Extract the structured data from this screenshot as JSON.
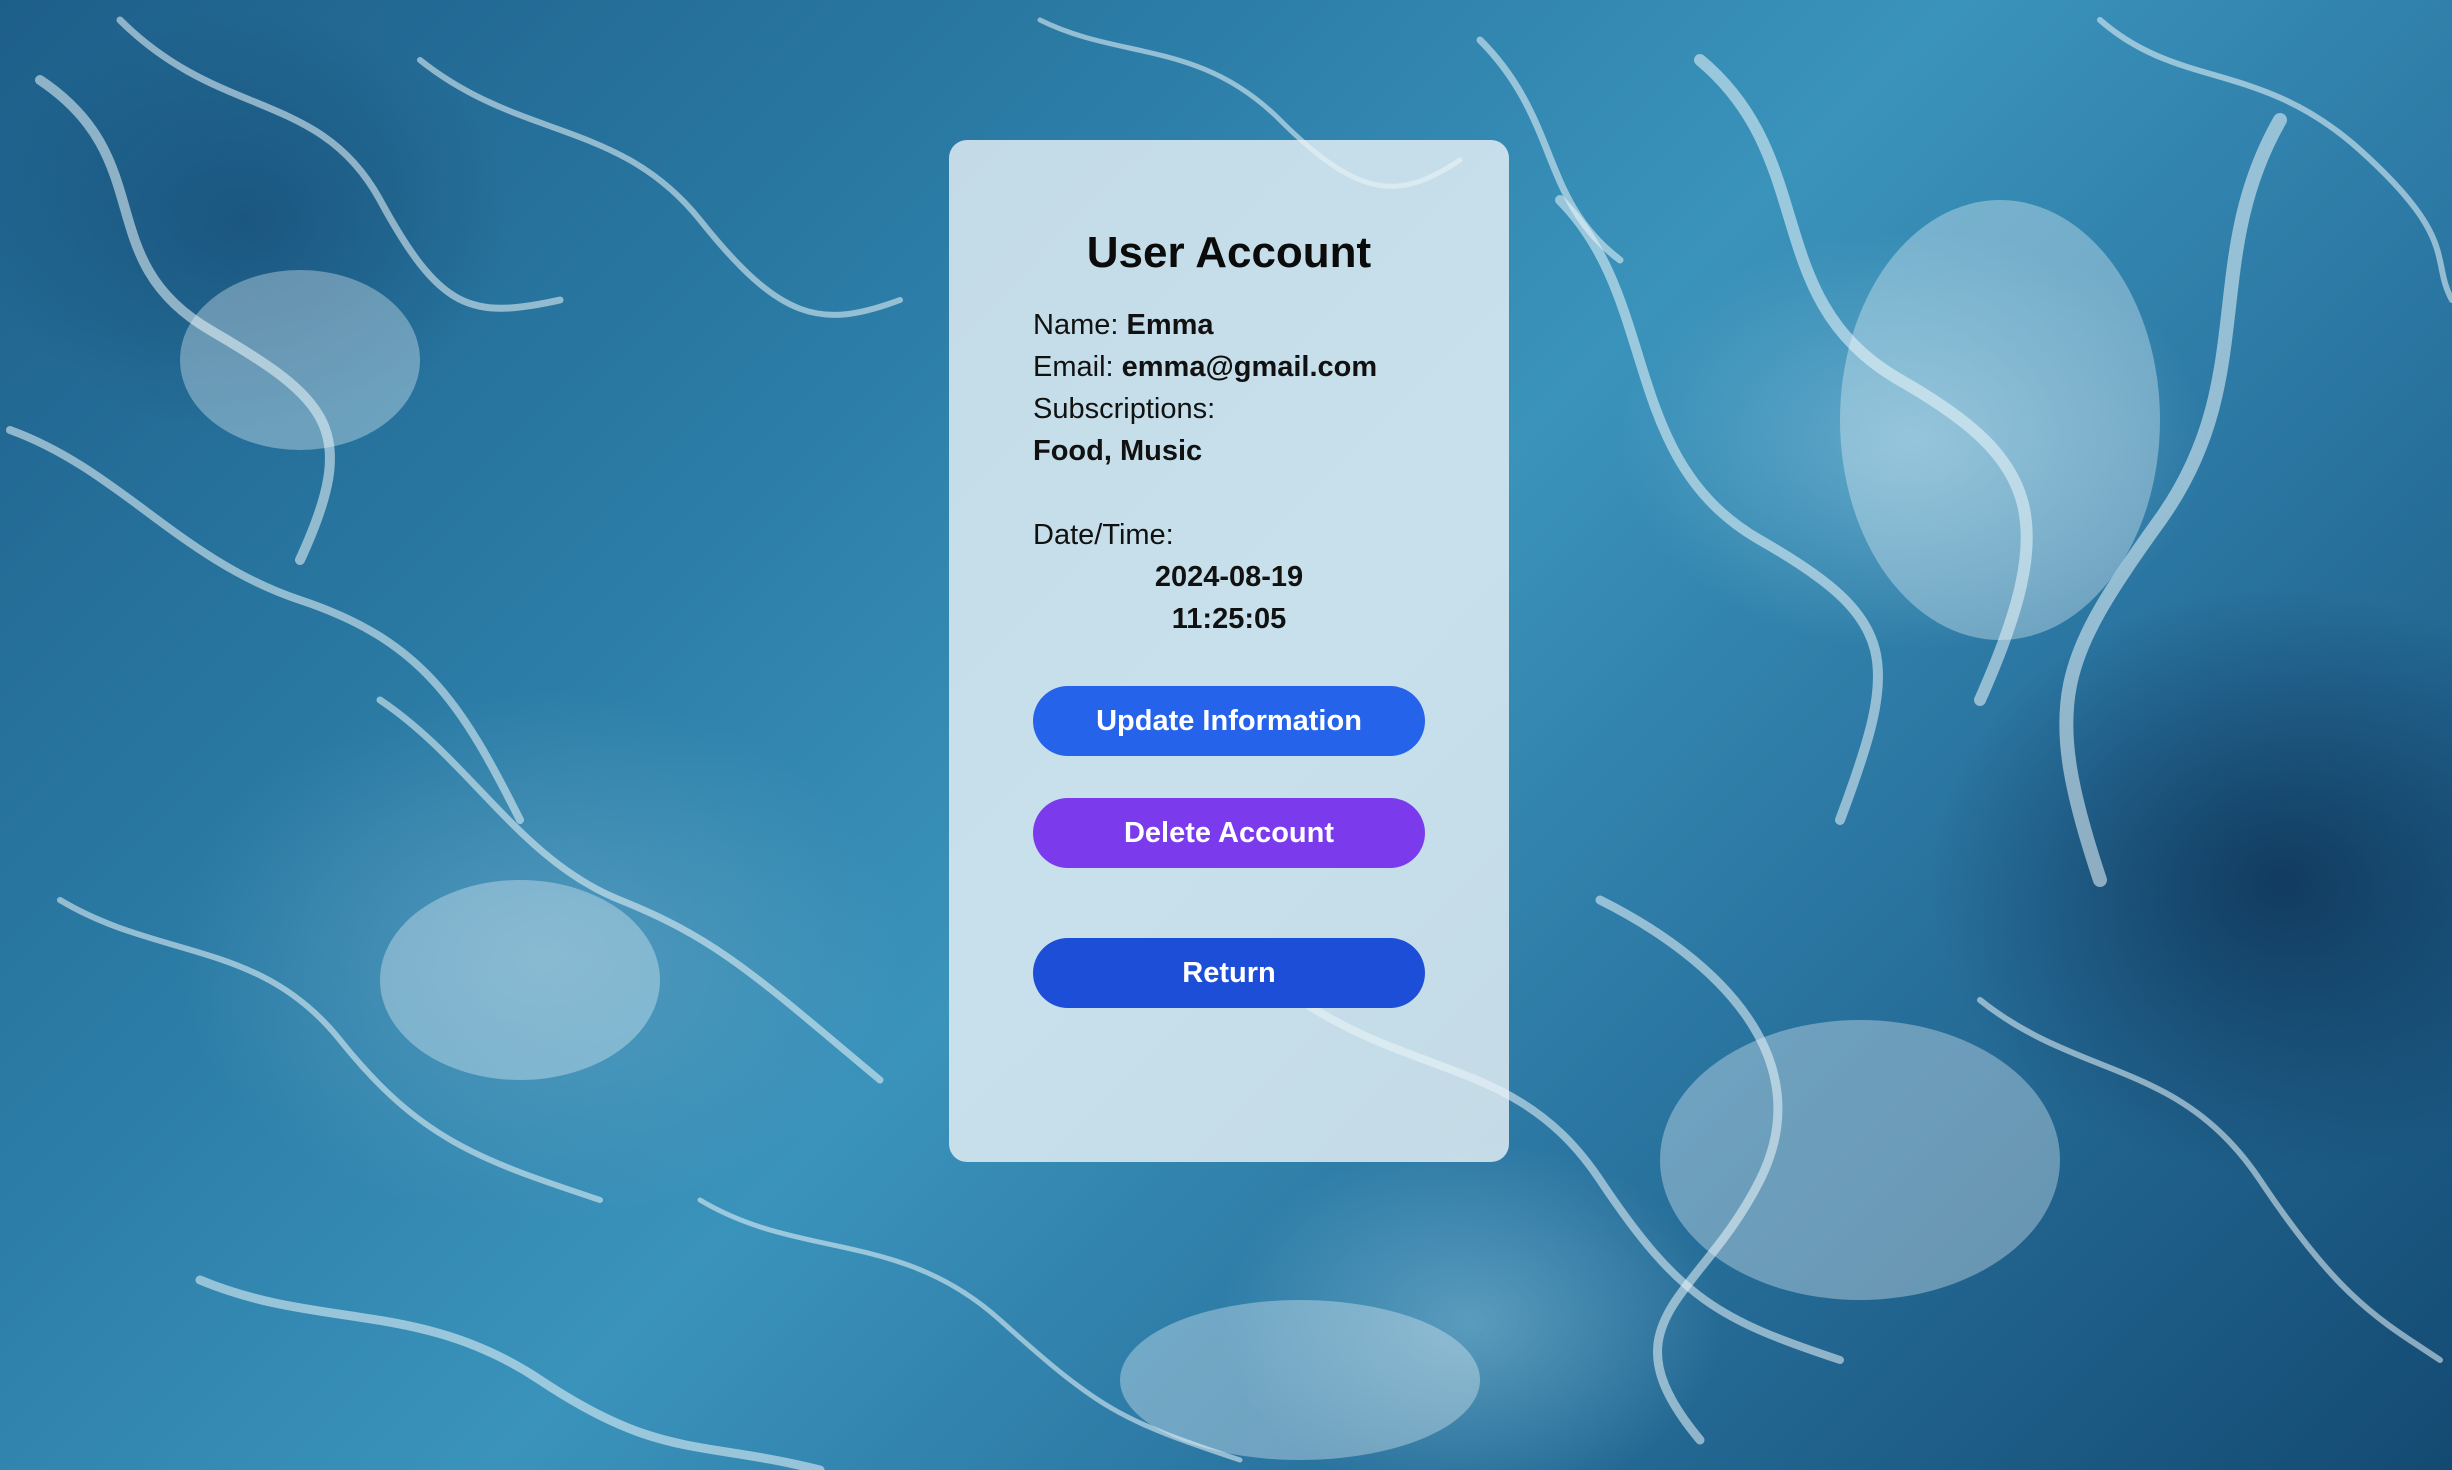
{
  "account": {
    "title": "User Account",
    "name_label": "Name: ",
    "name_value": "Emma",
    "email_label": "Email: ",
    "email_value": "emma@gmail.com",
    "subscriptions_label": "Subscriptions:",
    "subscriptions_value": "Food, Music",
    "datetime_label": "Date/Time:",
    "date_value": "2024-08-19",
    "time_value": "11:25:05"
  },
  "buttons": {
    "update_label": "Update Information",
    "delete_label": "Delete Account",
    "return_label": "Return"
  },
  "colors": {
    "update_button": "#2563eb",
    "delete_button": "#7c3aed",
    "return_button": "#1d4ed8",
    "card_background": "rgba(235,244,248,0.80)"
  },
  "background": {
    "image": "ocean-water-surface"
  }
}
